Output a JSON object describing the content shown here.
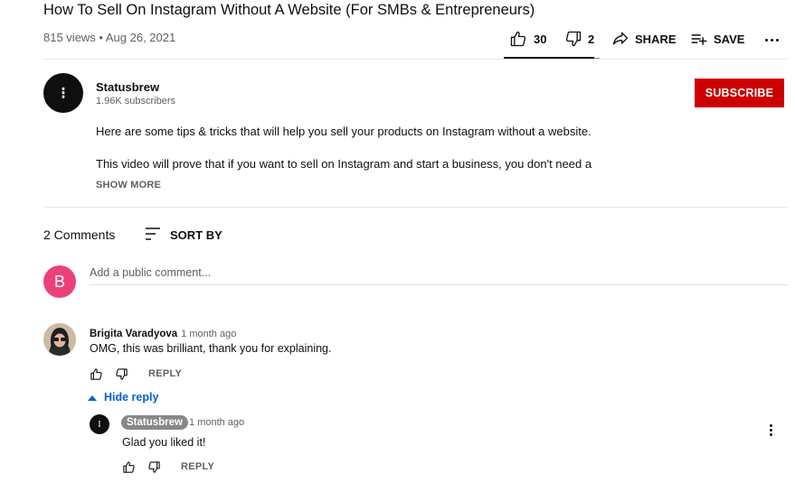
{
  "video": {
    "title": "How To Sell On Instagram Without A Website (For SMBs & Entrepreneurs)",
    "meta": "815 views • Aug 26, 2021",
    "likes": "30",
    "dislikes": "2",
    "share_label": "SHARE",
    "save_label": "SAVE"
  },
  "channel": {
    "avatar_glyph": "⁝",
    "name": "Statusbrew",
    "subscribers": "1.96K subscribers",
    "subscribe_label": "SUBSCRIBE"
  },
  "description": {
    "line1": "Here are some tips & tricks that will help you sell your products on Instagram without a website.",
    "line2": "This video will prove that if you want to sell on Instagram and start a business, you don't need a",
    "show_more": "SHOW MORE"
  },
  "comments_header": {
    "count": "2 Comments",
    "sort_label": "SORT BY"
  },
  "new_comment": {
    "avatar_letter": "B",
    "placeholder": "Add a public comment..."
  },
  "comments": [
    {
      "author": "Brigita Varadyova",
      "time": "1 month ago",
      "text": "OMG, this was brilliant, thank you for explaining.",
      "reply_label": "REPLY",
      "hide_reply_label": "Hide reply"
    }
  ],
  "replies": [
    {
      "author": "Statusbrew",
      "time": "1 month ago",
      "text": "Glad you liked it!",
      "reply_label": "REPLY"
    }
  ],
  "colors": {
    "subscribe": "#cc0000",
    "link_blue": "#065fd4",
    "avatar_b": "#ec407a",
    "owner_badge": "#888888"
  }
}
